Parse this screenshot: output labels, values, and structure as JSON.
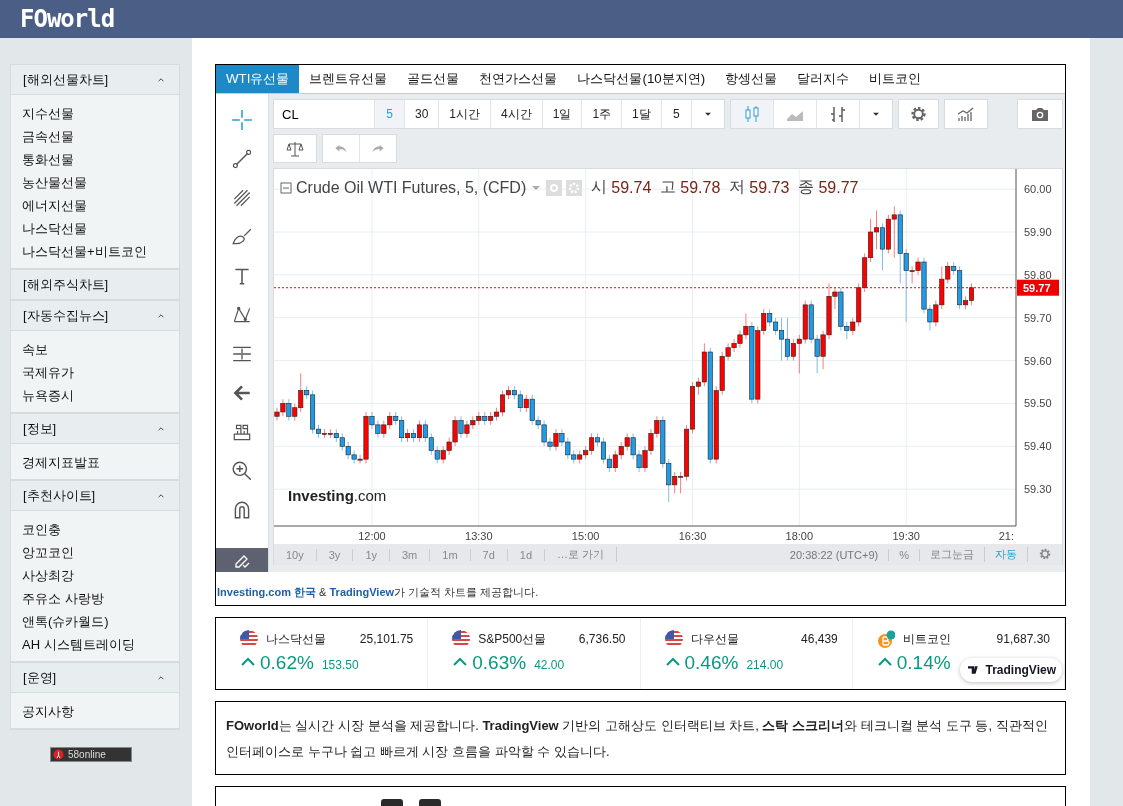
{
  "header": {
    "logo": "FOworld"
  },
  "sidebar": {
    "sections": [
      {
        "title": "[해외선물차트]",
        "expanded": true,
        "items": [
          "지수선물",
          "금속선물",
          "통화선물",
          "농산물선물",
          "에너지선물",
          "나스닥선물",
          "나스닥선물+비트코인"
        ]
      },
      {
        "title": "[해외주식차트]",
        "expanded": false
      },
      {
        "title": "[자동수집뉴스]",
        "expanded": true,
        "items": [
          "속보",
          "국제유가",
          "뉴욕증시"
        ]
      },
      {
        "title": "[정보]",
        "expanded": true,
        "items": [
          "경제지표발표"
        ]
      },
      {
        "title": "[추천사이트]",
        "expanded": true,
        "items": [
          "코인충",
          "앙꼬코인",
          "사상최강",
          "주유소 사랑방",
          "앤톡(슈카월드)",
          "AH 시스템트레이딩"
        ]
      },
      {
        "title": "[운영]",
        "expanded": true,
        "items": [
          "공지사항"
        ]
      }
    ],
    "counter": "58online"
  },
  "chart_widget": {
    "tabs": [
      {
        "label": "WTI유선물",
        "selected": true
      },
      {
        "label": "브렌트유선물",
        "selected": false
      },
      {
        "label": "골드선물",
        "selected": false
      },
      {
        "label": "천연가스선물",
        "selected": false
      },
      {
        "label": "나스닥선물(10분지연)",
        "selected": false
      },
      {
        "label": "항셍선물",
        "selected": false
      },
      {
        "label": "달러지수",
        "selected": false
      },
      {
        "label": "비트코인",
        "selected": false
      }
    ],
    "symbol": "CL",
    "intervals": [
      {
        "label": "5",
        "selected": true
      },
      {
        "label": "30",
        "selected": false
      },
      {
        "label": "1시간",
        "selected": false
      },
      {
        "label": "4시간",
        "selected": false
      },
      {
        "label": "1일",
        "selected": false
      },
      {
        "label": "1주",
        "selected": false
      },
      {
        "label": "1달",
        "selected": false
      }
    ],
    "interval_dropdown": "5",
    "chart_types": [
      {
        "kind": "candles",
        "selected": true
      },
      {
        "kind": "line",
        "selected": false
      },
      {
        "kind": "bars",
        "selected": false
      }
    ],
    "legend": {
      "title": "Crude Oil WTI Futures, 5, (CFD)",
      "ohlc": [
        {
          "label": "시",
          "value": "59.74"
        },
        {
          "label": "고",
          "value": "59.78"
        },
        {
          "label": "저",
          "value": "59.73"
        },
        {
          "label": "종",
          "value": "59.77"
        }
      ]
    },
    "chart_logo": "**Investing**.com",
    "chart_data": {
      "type": "candlestick",
      "grid": true,
      "ylim": [
        59.214,
        60.047
      ],
      "categories": [
        null,
        null,
        null,
        null,
        null,
        null,
        null,
        null,
        null,
        null,
        null,
        null,
        null,
        null,
        null,
        null,
        "12:00",
        null,
        null,
        null,
        null,
        null,
        null,
        null,
        null,
        null,
        null,
        null,
        null,
        null,
        null,
        null,
        null,
        null,
        "13:30",
        null,
        null,
        null,
        null,
        null,
        null,
        null,
        null,
        null,
        null,
        null,
        null,
        null,
        null,
        null,
        null,
        null,
        "15:00",
        null,
        null,
        null,
        null,
        null,
        null,
        null,
        null,
        null,
        null,
        null,
        null,
        null,
        null,
        null,
        null,
        null,
        "16:30",
        null,
        null,
        null,
        null,
        null,
        null,
        null,
        null,
        null,
        null,
        null,
        null,
        null,
        null,
        null,
        null,
        null,
        "18:00",
        null,
        null,
        null,
        null,
        null,
        null,
        null,
        null,
        null,
        null,
        null,
        null,
        null,
        null,
        null,
        null,
        null,
        "19:30",
        null,
        null,
        null,
        null,
        null,
        null,
        null,
        null,
        null,
        null,
        null,
        null,
        null,
        null,
        null,
        null,
        null,
        null
      ],
      "yticks": [
        {
          "value": 59.3,
          "label": "59.30"
        },
        {
          "value": 59.4,
          "label": "59.40"
        },
        {
          "value": 59.5,
          "label": "59.50"
        },
        {
          "value": 59.6,
          "label": "59.60"
        },
        {
          "value": 59.7,
          "label": "59.70"
        },
        {
          "value": 59.8,
          "label": "59.80"
        },
        {
          "value": 59.9,
          "label": "59.90"
        },
        {
          "value": 60.0,
          "label": "60.00"
        }
      ],
      "ohlc": [
        [
          59.47,
          59.49,
          59.46,
          59.48
        ],
        [
          59.48,
          59.51,
          59.47,
          59.5
        ],
        [
          59.5,
          59.51,
          59.46,
          59.47
        ],
        [
          59.47,
          59.5,
          59.46,
          59.49
        ],
        [
          59.49,
          59.57,
          59.48,
          59.53
        ],
        [
          59.53,
          59.54,
          59.51,
          59.52
        ],
        [
          59.52,
          59.53,
          59.43,
          59.44
        ],
        [
          59.44,
          59.45,
          59.42,
          59.43
        ],
        [
          59.43,
          59.44,
          59.42,
          59.43
        ],
        [
          59.43,
          59.44,
          59.42,
          59.43
        ],
        [
          59.43,
          59.44,
          59.41,
          59.42
        ],
        [
          59.42,
          59.43,
          59.39,
          59.4
        ],
        [
          59.4,
          59.41,
          59.37,
          59.38
        ],
        [
          59.38,
          59.39,
          59.36,
          59.37
        ],
        [
          59.37,
          59.38,
          59.36,
          59.37
        ],
        [
          59.37,
          59.48,
          59.36,
          59.47
        ],
        [
          59.47,
          59.48,
          59.44,
          59.45
        ],
        [
          59.45,
          59.46,
          59.42,
          59.43
        ],
        [
          59.43,
          59.46,
          59.42,
          59.45
        ],
        [
          59.45,
          59.48,
          59.44,
          59.47
        ],
        [
          59.47,
          59.48,
          59.45,
          59.46
        ],
        [
          59.46,
          59.47,
          59.41,
          59.42
        ],
        [
          59.42,
          59.44,
          59.41,
          59.43
        ],
        [
          59.43,
          59.44,
          59.41,
          59.42
        ],
        [
          59.42,
          59.46,
          59.41,
          59.45
        ],
        [
          59.45,
          59.46,
          59.41,
          59.42
        ],
        [
          59.42,
          59.43,
          59.38,
          59.39
        ],
        [
          59.39,
          59.4,
          59.36,
          59.37
        ],
        [
          59.37,
          59.4,
          59.36,
          59.39
        ],
        [
          59.39,
          59.42,
          59.38,
          59.41
        ],
        [
          59.41,
          59.47,
          59.4,
          59.46
        ],
        [
          59.46,
          59.47,
          59.42,
          59.43
        ],
        [
          59.43,
          59.46,
          59.42,
          59.45
        ],
        [
          59.45,
          59.47,
          59.44,
          59.46
        ],
        [
          59.46,
          59.48,
          59.45,
          59.47
        ],
        [
          59.47,
          59.48,
          59.45,
          59.46
        ],
        [
          59.46,
          59.48,
          59.45,
          59.47
        ],
        [
          59.47,
          59.49,
          59.46,
          59.48
        ],
        [
          59.48,
          59.53,
          59.47,
          59.52
        ],
        [
          59.52,
          59.54,
          59.51,
          59.53
        ],
        [
          59.53,
          59.54,
          59.51,
          59.52
        ],
        [
          59.52,
          59.53,
          59.48,
          59.49
        ],
        [
          59.49,
          59.52,
          59.48,
          59.51
        ],
        [
          59.51,
          59.52,
          59.45,
          59.46
        ],
        [
          59.46,
          59.47,
          59.44,
          59.45
        ],
        [
          59.45,
          59.46,
          59.4,
          59.41
        ],
        [
          59.41,
          59.42,
          59.39,
          59.4
        ],
        [
          59.4,
          59.44,
          59.39,
          59.43
        ],
        [
          59.43,
          59.44,
          59.4,
          59.41
        ],
        [
          59.41,
          59.42,
          59.37,
          59.38
        ],
        [
          59.38,
          59.39,
          59.36,
          59.37
        ],
        [
          59.37,
          59.39,
          59.36,
          59.38
        ],
        [
          59.38,
          59.4,
          59.37,
          59.39
        ],
        [
          59.39,
          59.43,
          59.38,
          59.42
        ],
        [
          59.42,
          59.43,
          59.4,
          59.41
        ],
        [
          59.41,
          59.42,
          59.36,
          59.37
        ],
        [
          59.37,
          59.38,
          59.34,
          59.35
        ],
        [
          59.35,
          59.39,
          59.34,
          59.38
        ],
        [
          59.38,
          59.41,
          59.37,
          59.4
        ],
        [
          59.4,
          59.43,
          59.39,
          59.42
        ],
        [
          59.42,
          59.43,
          59.37,
          59.38
        ],
        [
          59.38,
          59.39,
          59.34,
          59.35
        ],
        [
          59.35,
          59.4,
          59.34,
          59.39
        ],
        [
          59.39,
          59.44,
          59.38,
          59.43
        ],
        [
          59.43,
          59.47,
          59.42,
          59.46
        ],
        [
          59.46,
          59.47,
          59.35,
          59.36
        ],
        [
          59.36,
          59.37,
          59.27,
          59.31
        ],
        [
          59.31,
          59.34,
          59.29,
          59.33
        ],
        [
          59.33,
          59.34,
          59.29,
          59.33
        ],
        [
          59.33,
          59.45,
          59.32,
          59.44
        ],
        [
          59.44,
          59.55,
          59.43,
          59.54
        ],
        [
          59.54,
          59.56,
          59.52,
          59.55
        ],
        [
          59.55,
          59.64,
          59.54,
          59.62
        ],
        [
          59.62,
          59.63,
          59.36,
          59.37
        ],
        [
          59.37,
          59.54,
          59.36,
          59.53
        ],
        [
          59.53,
          59.62,
          59.52,
          59.61
        ],
        [
          59.61,
          59.64,
          59.6,
          59.63
        ],
        [
          59.63,
          59.65,
          59.62,
          59.64
        ],
        [
          59.64,
          59.67,
          59.63,
          59.66
        ],
        [
          59.66,
          59.71,
          59.65,
          59.68
        ],
        [
          59.68,
          59.69,
          59.5,
          59.51
        ],
        [
          59.51,
          59.68,
          59.5,
          59.67
        ],
        [
          59.67,
          59.72,
          59.66,
          59.71
        ],
        [
          59.71,
          59.72,
          59.68,
          59.69
        ],
        [
          59.69,
          59.7,
          59.66,
          59.67
        ],
        [
          59.67,
          59.7,
          59.6,
          59.65
        ],
        [
          59.65,
          59.7,
          59.6,
          59.61
        ],
        [
          59.61,
          59.65,
          59.6,
          59.64
        ],
        [
          59.64,
          59.66,
          59.57,
          59.65
        ],
        [
          59.65,
          59.74,
          59.64,
          59.73
        ],
        [
          59.73,
          59.74,
          59.64,
          59.65
        ],
        [
          59.65,
          59.66,
          59.57,
          59.61
        ],
        [
          59.61,
          59.67,
          59.58,
          59.66
        ],
        [
          59.66,
          59.78,
          59.65,
          59.75
        ],
        [
          59.75,
          59.77,
          59.72,
          59.76
        ],
        [
          59.76,
          59.77,
          59.67,
          59.68
        ],
        [
          59.68,
          59.69,
          59.65,
          59.67
        ],
        [
          59.67,
          59.7,
          59.66,
          59.69
        ],
        [
          59.69,
          59.78,
          59.68,
          59.77
        ],
        [
          59.77,
          59.85,
          59.76,
          59.84
        ],
        [
          59.84,
          59.93,
          59.83,
          59.9
        ],
        [
          59.9,
          59.95,
          59.86,
          59.91
        ],
        [
          59.91,
          59.92,
          59.81,
          59.86
        ],
        [
          59.86,
          59.94,
          59.85,
          59.93
        ],
        [
          59.93,
          59.96,
          59.84,
          59.94
        ],
        [
          59.94,
          59.95,
          59.78,
          59.85
        ],
        [
          59.85,
          59.86,
          59.69,
          59.81
        ],
        [
          59.81,
          59.82,
          59.78,
          59.81
        ],
        [
          59.81,
          59.84,
          59.8,
          59.83
        ],
        [
          59.83,
          59.84,
          59.71,
          59.72
        ],
        [
          59.72,
          59.73,
          59.67,
          59.69
        ],
        [
          59.69,
          59.74,
          59.68,
          59.73
        ],
        [
          59.73,
          59.82,
          59.72,
          59.79
        ],
        [
          59.79,
          59.83,
          59.78,
          59.82
        ],
        [
          59.82,
          59.83,
          59.8,
          59.81
        ],
        [
          59.81,
          59.82,
          59.72,
          59.73
        ],
        [
          59.73,
          59.75,
          59.72,
          59.74
        ],
        [
          59.74,
          59.78,
          59.73,
          59.77
        ],
        null,
        null,
        null,
        null,
        null,
        null,
        null
      ],
      "ref_lines": [
        {
          "axis": "y",
          "value": 59.77,
          "label": "59.77"
        }
      ]
    },
    "axis_edge_label": "21:",
    "range_buttons": [
      "10y",
      "3y",
      "1y",
      "3m",
      "1m",
      "7d",
      "1d",
      "…로 가기"
    ],
    "clock": "20:38:22 (UTC+9)",
    "scale_options": [
      {
        "label": "%",
        "selected": false
      },
      {
        "label": "로그눈금",
        "selected": false
      },
      {
        "label": "자동",
        "selected": true
      }
    ],
    "credit": [
      {
        "kind": "link",
        "text": "Investing.com 한국"
      },
      {
        "kind": "text",
        "text": " & "
      },
      {
        "kind": "link",
        "text": "TradingView"
      },
      {
        "kind": "text",
        "text": "가 기술적 차트를 제공합니다."
      }
    ]
  },
  "tickers": [
    {
      "kind": "flag",
      "name": "나스닥선물",
      "price": "25,101.75",
      "rising": true,
      "change_pct": "0.62%",
      "change": "153.50"
    },
    {
      "kind": "flag",
      "name": "S&P500선물",
      "price": "6,736.50",
      "rising": true,
      "change_pct": "0.63%",
      "change": "42.00"
    },
    {
      "kind": "flag",
      "name": "다우선물",
      "price": "46,439",
      "rising": true,
      "change_pct": "0.46%",
      "change": "214.00"
    },
    {
      "kind": "coin",
      "name": "비트코인",
      "price": "91,687.30",
      "rising": true,
      "change_pct": "0.14%"
    }
  ],
  "tradingview_badge": "TradingView",
  "description": "**FOworld**는 실시간 시장 분석을 제공합니다. **TradingView** 기반의 고해상도 인터랙티브 차트, **스탁 스크리너**와 테크니컬 분석 도구 등, 직관적인 인터페이스로 누구나 쉽고 빠르게 시장 흐름을 파악할 수 있습니다."
}
